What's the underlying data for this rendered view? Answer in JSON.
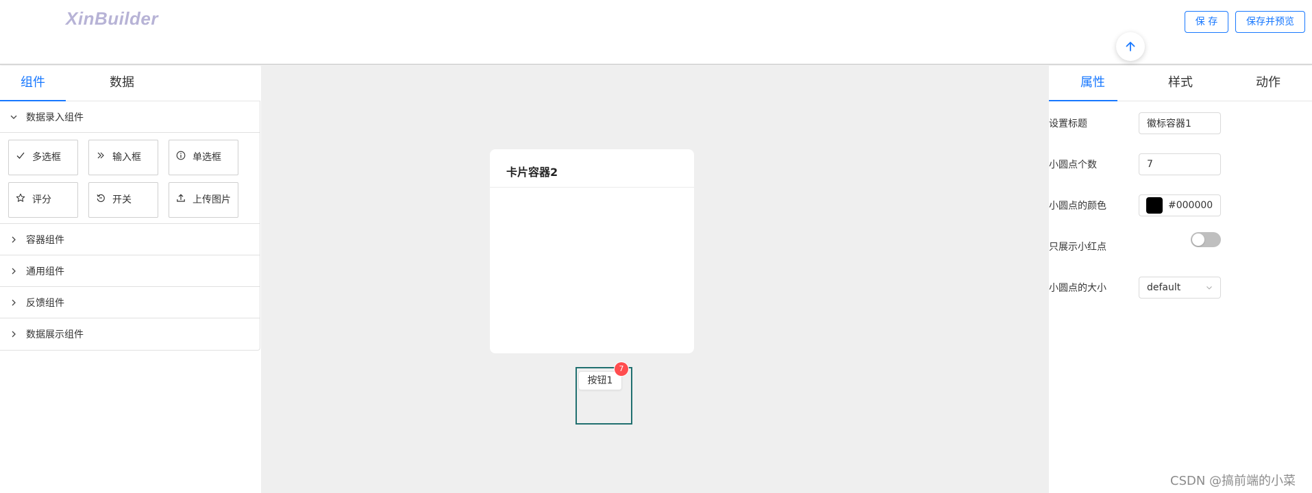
{
  "header": {
    "logo": "XinBuilder",
    "save_label": "保 存",
    "save_preview_label": "保存并预览"
  },
  "left_panel": {
    "tabs": [
      {
        "label": "组件",
        "active": true
      },
      {
        "label": "数据",
        "active": false
      }
    ],
    "groups": [
      {
        "title": "数据录入组件",
        "expanded": true,
        "items": [
          {
            "label": "多选框",
            "icon": "check-icon"
          },
          {
            "label": "输入框",
            "icon": "double-chevron-right-icon"
          },
          {
            "label": "单选框",
            "icon": "info-circle-icon"
          },
          {
            "label": "评分",
            "icon": "star-icon"
          },
          {
            "label": "开关",
            "icon": "undo-icon"
          },
          {
            "label": "上传图片",
            "icon": "upload-icon"
          }
        ]
      },
      {
        "title": "容器组件",
        "expanded": false
      },
      {
        "title": "通用组件",
        "expanded": false
      },
      {
        "title": "反馈组件",
        "expanded": false
      },
      {
        "title": "数据展示组件",
        "expanded": false
      }
    ]
  },
  "canvas": {
    "card_title": "卡片容器2",
    "button_label": "按钮1",
    "badge_count": "7"
  },
  "right_panel": {
    "tabs": [
      {
        "label": "属性",
        "active": true
      },
      {
        "label": "样式",
        "active": false
      },
      {
        "label": "动作",
        "active": false
      }
    ],
    "props": {
      "title_label": "设置标题",
      "title_value": "徽标容器1",
      "count_label": "小圆点个数",
      "count_value": "7",
      "color_label": "小圆点的颜色",
      "color_value": "#000000",
      "dot_only_label": "只展示小红点",
      "dot_only_value": false,
      "size_label": "小圆点的大小",
      "size_value": "default"
    }
  },
  "colors": {
    "accent": "#1677ff",
    "badge": "#ff4d4f",
    "canvas_bg": "#efefef",
    "logo": "#b7b3d6"
  },
  "watermark": "CSDN @搞前端的小菜"
}
